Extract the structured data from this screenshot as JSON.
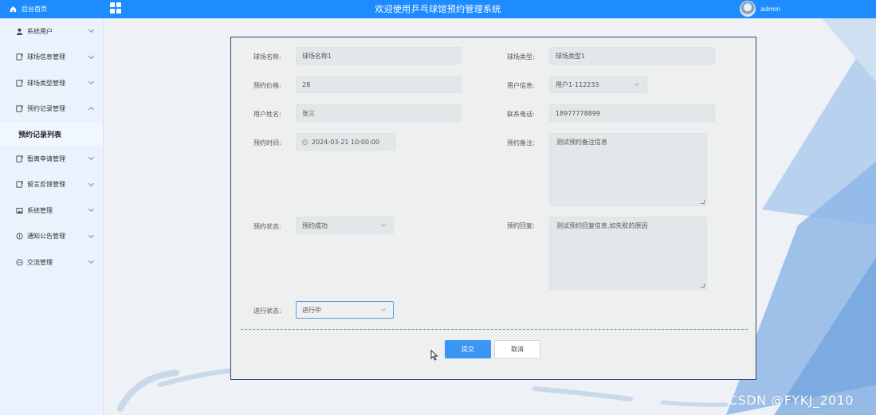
{
  "topbar": {
    "home_label": "后台首页",
    "title": "欢迎使用乒乓球馆预约管理系统",
    "username": "admin"
  },
  "sidebar": {
    "items": [
      {
        "label": "系统用户",
        "icon": "user-icon",
        "expanded": false
      },
      {
        "label": "球场信息管理",
        "icon": "document-icon",
        "expanded": false
      },
      {
        "label": "球场类型管理",
        "icon": "document-icon",
        "expanded": false
      },
      {
        "label": "预约记录管理",
        "icon": "document-icon",
        "expanded": true
      },
      {
        "label": "暂离申请管理",
        "icon": "document-icon",
        "expanded": false
      },
      {
        "label": "留言反馈管理",
        "icon": "document-icon",
        "expanded": false
      },
      {
        "label": "系统管理",
        "icon": "picture-icon",
        "expanded": false
      },
      {
        "label": "通知公告管理",
        "icon": "info-circle-icon",
        "expanded": false
      },
      {
        "label": "交流管理",
        "icon": "chat-icon",
        "expanded": false
      }
    ],
    "subitem": "预约记录列表"
  },
  "form": {
    "court_name": {
      "label": "球场名称:",
      "value": "球场名称1"
    },
    "court_type": {
      "label": "球场类型:",
      "value": "球场类型1"
    },
    "price": {
      "label": "预约价格:",
      "value": "28"
    },
    "user_info": {
      "label": "用户信息:",
      "value": "用户1-112233"
    },
    "user_name": {
      "label": "用户姓名:",
      "value": "张三"
    },
    "phone": {
      "label": "联系电话:",
      "value": "18977778899"
    },
    "time": {
      "label": "预约时间:",
      "value": "2024-03-21 10:00:00"
    },
    "remark": {
      "label": "预约备注:",
      "value": "测试预约备注信息"
    },
    "status": {
      "label": "预约状态:",
      "value": "预约成功"
    },
    "reply": {
      "label": "预约回复:",
      "value": "测试预约回复信息,如失败的原因"
    },
    "progress": {
      "label": "进行状态:",
      "value": "进行中"
    }
  },
  "buttons": {
    "submit": "提交",
    "cancel": "取消"
  },
  "watermark": "CSDN @FYKJ_2010",
  "colors": {
    "header": "#1e8cff",
    "sidebar": "#eaf3fd",
    "primary_button": "#3b95f3",
    "card_border": "#2c4a6e"
  }
}
